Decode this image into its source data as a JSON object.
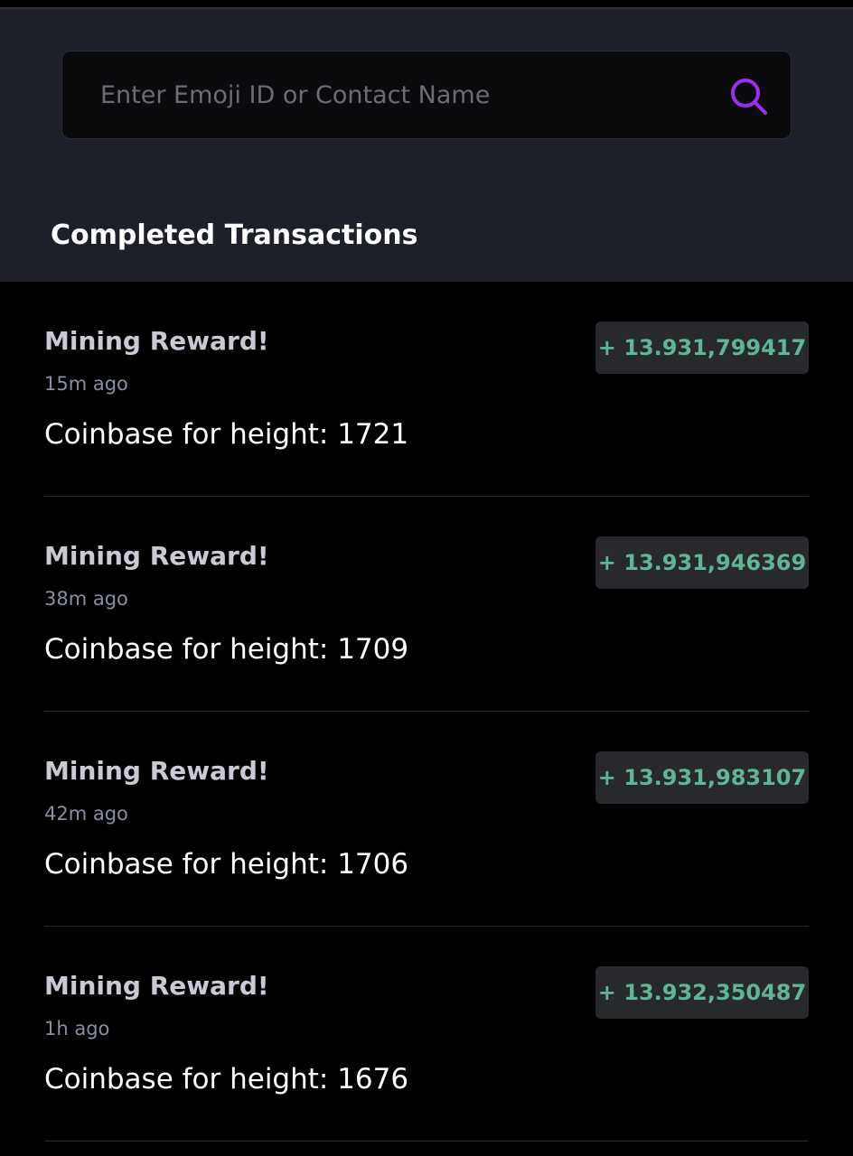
{
  "search": {
    "placeholder": "Enter Emoji ID or Contact Name",
    "value": "",
    "icon": "search-icon",
    "icon_color": "#9b2ff0"
  },
  "section": {
    "title": "Completed Transactions"
  },
  "colors": {
    "header_bg": "#1e2029",
    "list_bg": "#000000",
    "amount_text": "#5fb594",
    "amount_badge_bg": "#27292c"
  },
  "transactions": [
    {
      "title": "Mining Reward!",
      "time": "15m ago",
      "description": "Coinbase for height: 1721",
      "amount": "+ 13.931,799417"
    },
    {
      "title": "Mining Reward!",
      "time": "38m ago",
      "description": "Coinbase for height: 1709",
      "amount": "+ 13.931,946369"
    },
    {
      "title": "Mining Reward!",
      "time": "42m ago",
      "description": "Coinbase for height: 1706",
      "amount": "+ 13.931,983107"
    },
    {
      "title": "Mining Reward!",
      "time": "1h ago",
      "description": "Coinbase for height: 1676",
      "amount": "+ 13.932,350487"
    }
  ]
}
